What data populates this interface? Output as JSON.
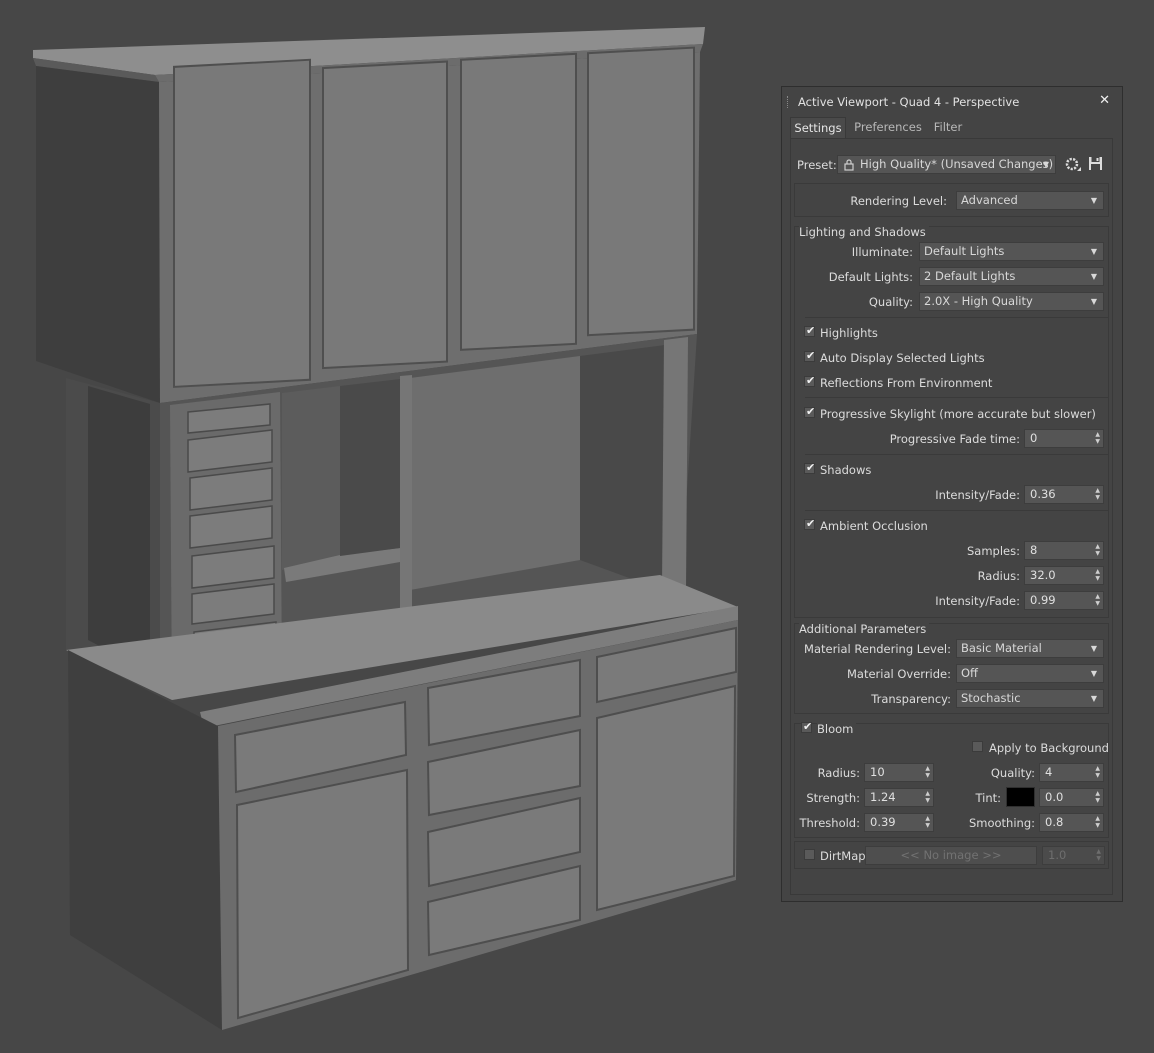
{
  "panel": {
    "title": "Active Viewport - Quad 4 - Perspective",
    "close_label": "✕",
    "tabs": [
      "Settings",
      "Preferences",
      "Filter"
    ],
    "preset": {
      "label": "Preset:",
      "value": "High Quality* (Unsaved Changes)"
    },
    "rendering_level": {
      "label": "Rendering Level:",
      "value": "Advanced"
    },
    "lighting": {
      "title": "Lighting and Shadows",
      "illuminate": {
        "label": "Illuminate:",
        "value": "Default Lights"
      },
      "default_lights": {
        "label": "Default Lights:",
        "value": "2 Default Lights"
      },
      "quality": {
        "label": "Quality:",
        "value": "2.0X - High Quality"
      },
      "highlights": {
        "label": "Highlights",
        "checked": true
      },
      "auto_display": {
        "label": "Auto Display Selected Lights",
        "checked": true
      },
      "reflections": {
        "label": "Reflections From Environment",
        "checked": true
      },
      "progressive": {
        "label": "Progressive Skylight (more accurate but slower)",
        "checked": true
      },
      "fade_time": {
        "label": "Progressive Fade time:",
        "value": "0"
      },
      "shadows": {
        "label": "Shadows",
        "checked": true
      },
      "shadow_intensity": {
        "label": "Intensity/Fade:",
        "value": "0.36"
      },
      "ao": {
        "label": "Ambient Occlusion",
        "checked": true
      },
      "samples": {
        "label": "Samples:",
        "value": "8"
      },
      "radius": {
        "label": "Radius:",
        "value": "32.0"
      },
      "ao_intensity": {
        "label": "Intensity/Fade:",
        "value": "0.99"
      }
    },
    "additional": {
      "title": "Additional Parameters",
      "material_level": {
        "label": "Material Rendering Level:",
        "value": "Basic Material"
      },
      "material_override": {
        "label": "Material Override:",
        "value": "Off"
      },
      "transparency": {
        "label": "Transparency:",
        "value": "Stochastic"
      }
    },
    "bloom": {
      "label": "Bloom",
      "checked": true,
      "apply_bg": {
        "label": "Apply to Background",
        "checked": false
      },
      "radius": {
        "label": "Radius:",
        "value": "10"
      },
      "quality": {
        "label": "Quality:",
        "value": "4"
      },
      "strength": {
        "label": "Strength:",
        "value": "1.24"
      },
      "tint": {
        "label": "Tint:",
        "value": "0.0",
        "color": "#000000"
      },
      "threshold": {
        "label": "Threshold:",
        "value": "0.39"
      },
      "smoothing": {
        "label": "Smoothing:",
        "value": "0.8"
      },
      "dirtmap": {
        "label": "DirtMap",
        "checked": false,
        "button": "<< No image >>",
        "value": "1.0"
      }
    }
  }
}
